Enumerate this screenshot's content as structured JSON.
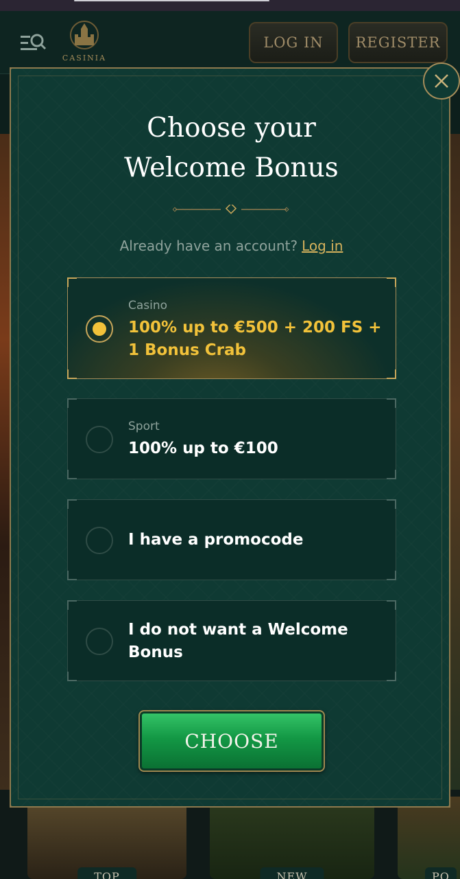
{
  "header": {
    "brand": "CASINIA",
    "login_label": "LOG IN",
    "register_label": "REGISTER"
  },
  "modal": {
    "title_line1": "Choose your",
    "title_line2": "Welcome Bonus",
    "account_prompt": "Already have an account?",
    "login_link": "Log in",
    "options": [
      {
        "category": "Casino",
        "text": "100% up to €500 + 200 FS + 1 Bonus Crab",
        "selected": true
      },
      {
        "category": "Sport",
        "text": "100% up to €100",
        "selected": false
      },
      {
        "category": "",
        "text": "I have a promocode",
        "selected": false
      },
      {
        "category": "",
        "text": "I do not want a Welcome Bonus",
        "selected": false
      }
    ],
    "choose_label": "CHOOSE"
  },
  "background": {
    "tiles": [
      "TOP",
      "NEW",
      "PO"
    ]
  },
  "colors": {
    "modal_bg": "#0f3a33",
    "gold_accent": "#a68d5a",
    "selected_text": "#f2c23a",
    "button_green": "#139845"
  }
}
